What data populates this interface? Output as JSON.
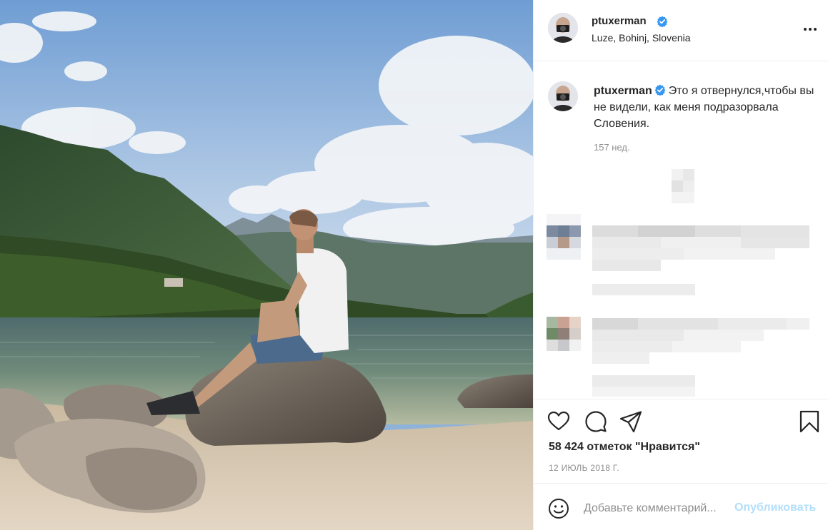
{
  "post": {
    "username": "ptuxerman",
    "verified": true,
    "location": "Luze, Bohinj, Slovenia",
    "caption": "Это я отвернулся,чтобы вы не видели, как меня подразорвала Словения.",
    "caption_time": "157 нед.",
    "likes_text": "58 424 отметок \"Нравится\"",
    "date": "12 ИЮЛЬ 2018 Г."
  },
  "comment_box": {
    "placeholder": "Добавьте комментарий...",
    "publish_label": "Опубликовать"
  },
  "icons": {
    "more": "more-options-icon",
    "like": "heart-icon",
    "comment": "comment-bubble-icon",
    "share": "send-paper-plane-icon",
    "save": "bookmark-icon",
    "emoji": "smiley-face-icon",
    "verified": "verified-badge-icon"
  },
  "colors": {
    "verified_blue": "#3897f0",
    "publish_disabled": "#b2dffc",
    "muted_text": "#8e8e8e"
  }
}
